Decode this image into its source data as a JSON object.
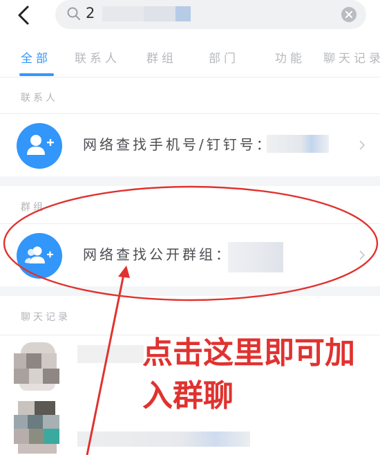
{
  "search": {
    "query": "2",
    "back_icon": "chevron-left-icon",
    "search_icon": "magnifier-icon",
    "clear_icon": "close-circle-icon"
  },
  "tabs": [
    {
      "label": "全部",
      "active": true
    },
    {
      "label": "联系人",
      "active": false
    },
    {
      "label": "群组",
      "active": false
    },
    {
      "label": "部门",
      "active": false
    },
    {
      "label": "功能",
      "active": false
    },
    {
      "label": "聊天记录",
      "active": false
    }
  ],
  "sections": {
    "contacts": {
      "label": "联系人",
      "item_label": "网络查找手机号/钉钉号：2",
      "icon": "add-person-icon"
    },
    "groups": {
      "label": "群组",
      "item_label": "网络查找公开群组：.",
      "icon": "add-group-icon"
    },
    "chat_history": {
      "label": "聊天记录"
    }
  },
  "annotation": {
    "text_line1": "点击这里即可加",
    "text_line2": "入群聊"
  },
  "colors": {
    "accent": "#3296fa",
    "annotation_red": "#e0322f"
  }
}
